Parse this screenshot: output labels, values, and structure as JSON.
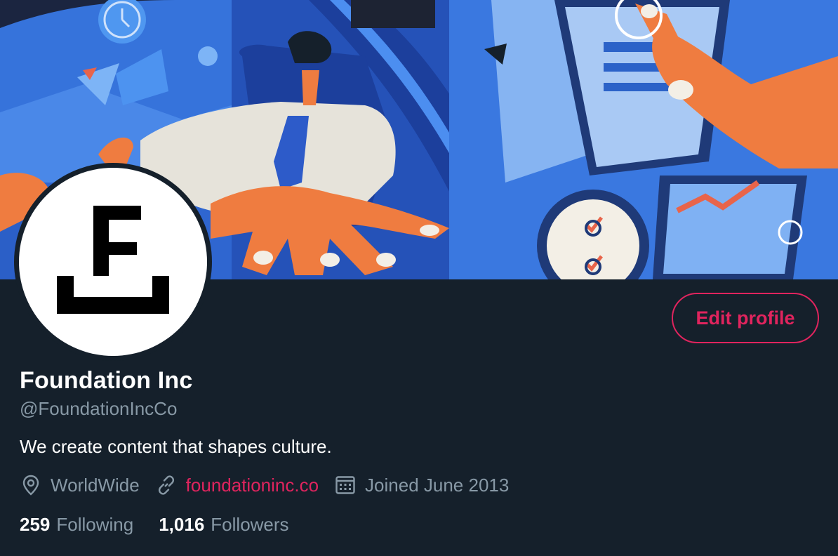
{
  "profile": {
    "name": "Foundation Inc",
    "handle": "@FoundationIncCo",
    "bio": "We create content that shapes culture.",
    "location": "WorldWide",
    "website": "foundationinc.co",
    "joined": "Joined June 2013",
    "edit_label": "Edit profile"
  },
  "stats": {
    "following_count": "259",
    "following_label": "Following",
    "followers_count": "1,016",
    "followers_label": "Followers"
  },
  "icons": {
    "location": "location-pin-icon",
    "website": "link-icon",
    "joined": "calendar-icon"
  },
  "colors": {
    "background": "#15202b",
    "accent": "#e0245e",
    "secondary_text": "#8899a6",
    "primary_text": "#ffffff"
  }
}
